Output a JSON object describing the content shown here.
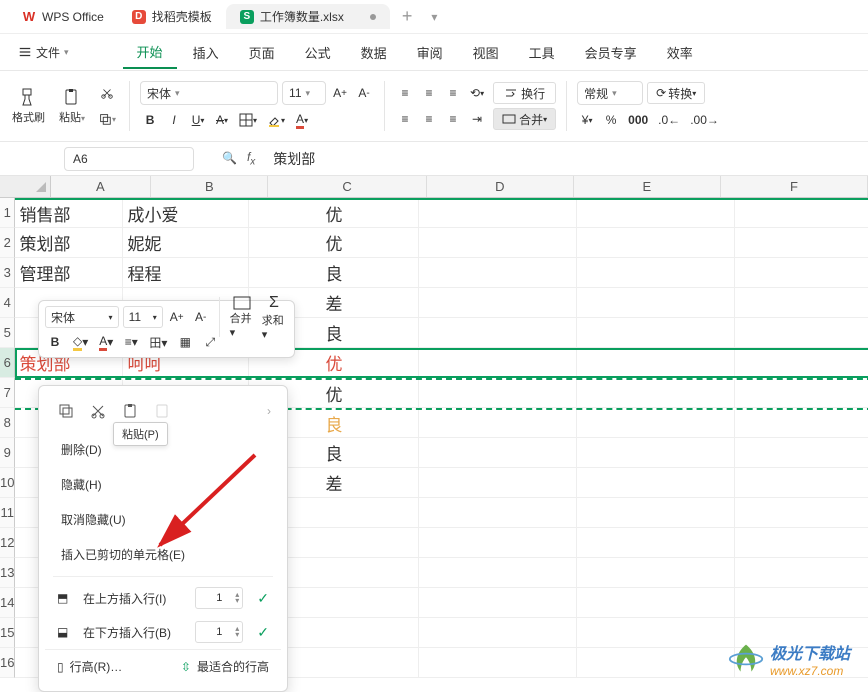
{
  "titlebar": {
    "tabs": [
      {
        "label": "WPS Office"
      },
      {
        "label": "找稻壳模板"
      },
      {
        "label": "工作簿数量.xlsx"
      }
    ],
    "plus": "+"
  },
  "menu": {
    "file": "文件",
    "items": [
      "开始",
      "插入",
      "页面",
      "公式",
      "数据",
      "审阅",
      "视图",
      "工具",
      "会员专享",
      "效率"
    ],
    "active_index": 0
  },
  "ribbon": {
    "format_brush": "格式刷",
    "paste": "粘贴",
    "font_name": "宋体",
    "font_size": "11",
    "wrap": "换行",
    "merge": "合并",
    "number_format": "常规",
    "convert": "转换",
    "percent": "%",
    "currency": "¥"
  },
  "namebox": "A6",
  "fx_value": "策划部",
  "cols": [
    "A",
    "B",
    "C",
    "D",
    "E",
    "F"
  ],
  "rows": [
    "1",
    "2",
    "3",
    "4",
    "5",
    "6",
    "7",
    "8",
    "9",
    "10",
    "11",
    "12",
    "13",
    "14",
    "15",
    "16"
  ],
  "data": {
    "A1": "销售部",
    "B1": "成小爱",
    "C1": "优",
    "A2": "策划部",
    "B2": "妮妮",
    "C2": "优",
    "A3": "管理部",
    "B3": "程程",
    "C3": "良",
    "C4": "差",
    "C5": "良",
    "A6": "策划部",
    "B6": "呵呵",
    "C6": "优",
    "C7": "优",
    "C8": "良",
    "C9": "良",
    "C10": "差"
  },
  "mini_toolbar": {
    "font_name": "宋体",
    "font_size": "11",
    "merge": "合并",
    "sum": "求和"
  },
  "context_menu": {
    "tooltip": "粘贴(P)",
    "items": [
      "删除(D)",
      "隐藏(H)",
      "取消隐藏(U)",
      "插入已剪切的单元格(E)"
    ],
    "insert_above": "在上方插入行(I)",
    "insert_below": "在下方插入行(B)",
    "spin_value": "1",
    "row_height": "行高(R)…",
    "best_fit": "最适合的行高"
  },
  "watermark": {
    "title": "极光下载站",
    "url": "www.xz7.com"
  }
}
